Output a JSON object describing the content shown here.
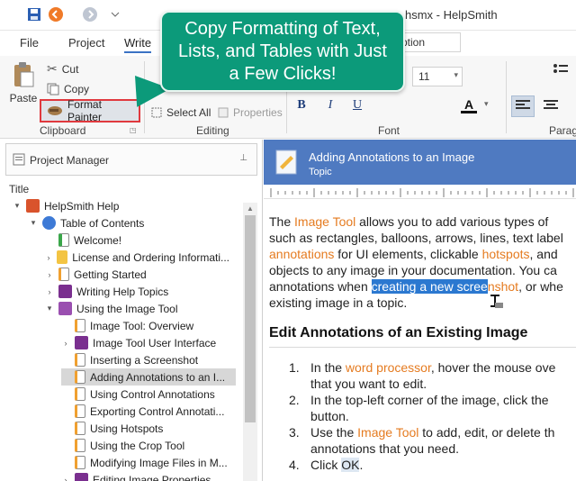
{
  "window": {
    "title": "hsmx - HelpSmith"
  },
  "tabs": {
    "file": "File",
    "project": "Project",
    "write": "Write"
  },
  "ribbon": {
    "caption_value": "ption",
    "clipboard": {
      "paste": "Paste",
      "cut": "Cut",
      "copy": "Copy",
      "format_painter": "Format Painter",
      "label": "Clipboard"
    },
    "editing": {
      "select_all": "Select All",
      "properties": "Properties",
      "label": "Editing"
    },
    "font": {
      "size": "11",
      "bold": "B",
      "italic": "I",
      "underline": "U",
      "font_color": "A",
      "label": "Font"
    },
    "paragraph": {
      "label": "Parag"
    }
  },
  "callout": {
    "line1": "Copy Formatting of Text,",
    "line2": "Lists, and Tables with Just",
    "line3": "a Few Clicks!"
  },
  "project_manager": {
    "title": "Project Manager",
    "column": "Title",
    "tree": [
      {
        "label": "HelpSmith Help",
        "arrow": "▾",
        "icon": "help-book"
      },
      {
        "label": "Table of Contents",
        "arrow": "▾",
        "icon": "question"
      },
      {
        "label": "Welcome!",
        "arrow": "",
        "icon": "check-page"
      },
      {
        "label": "License and Ordering Informati...",
        "arrow": "›",
        "icon": "folder"
      },
      {
        "label": "Getting Started",
        "arrow": "›",
        "icon": "page"
      },
      {
        "label": "Writing Help Topics",
        "arrow": "›",
        "icon": "book"
      },
      {
        "label": "Using the Image Tool",
        "arrow": "▾",
        "icon": "open-book"
      },
      {
        "label": "Image Tool: Overview",
        "arrow": "",
        "icon": "page"
      },
      {
        "label": "Image Tool User Interface",
        "arrow": "›",
        "icon": "book"
      },
      {
        "label": "Inserting a Screenshot",
        "arrow": "",
        "icon": "page"
      },
      {
        "label": "Adding Annotations to an I...",
        "arrow": "",
        "icon": "page"
      },
      {
        "label": "Using Control Annotations",
        "arrow": "",
        "icon": "page"
      },
      {
        "label": "Exporting Control Annotati...",
        "arrow": "",
        "icon": "page"
      },
      {
        "label": "Using Hotspots",
        "arrow": "",
        "icon": "page"
      },
      {
        "label": "Using the Crop Tool",
        "arrow": "",
        "icon": "page"
      },
      {
        "label": "Modifying Image Files in M...",
        "arrow": "",
        "icon": "page"
      },
      {
        "label": "Editing Image Properties",
        "arrow": "›",
        "icon": "book"
      }
    ]
  },
  "topic": {
    "title": "Adding Annotations to an Image",
    "subtitle": "Topic"
  },
  "doc": {
    "p1a": "The ",
    "p1b": "Image Tool",
    "p1c": " allows you to add various types of",
    "p2": "such as rectangles, balloons, arrows, lines, text label",
    "p3a": "annotations",
    "p3b": " for UI elements, clickable ",
    "p3c": "hotspots",
    "p3d": ", and",
    "p4": "objects to any image in your documentation. You ca",
    "p5a": "annotations when ",
    "p5b": "creating a new scree",
    "p5c": "nshot",
    "p5d": ", or whe",
    "p6": "existing image in a topic.",
    "heading": "Edit Annotations of an Existing Image",
    "li1a": "In the ",
    "li1b": "word processor",
    "li1c": ", hover the mouse ove",
    "li1d": "that you want to edit.",
    "li2a": "In the top-left corner of the image, click the ",
    "li2b": "button.",
    "li3a": "Use the ",
    "li3b": "Image Tool",
    "li3c": " to add, edit, or delete th",
    "li3d": "annotations that you need.",
    "li4a": "Click ",
    "li4b": "OK",
    "li4c": ".",
    "n1": "1.",
    "n2": "2.",
    "n3": "3.",
    "n4": "4."
  }
}
